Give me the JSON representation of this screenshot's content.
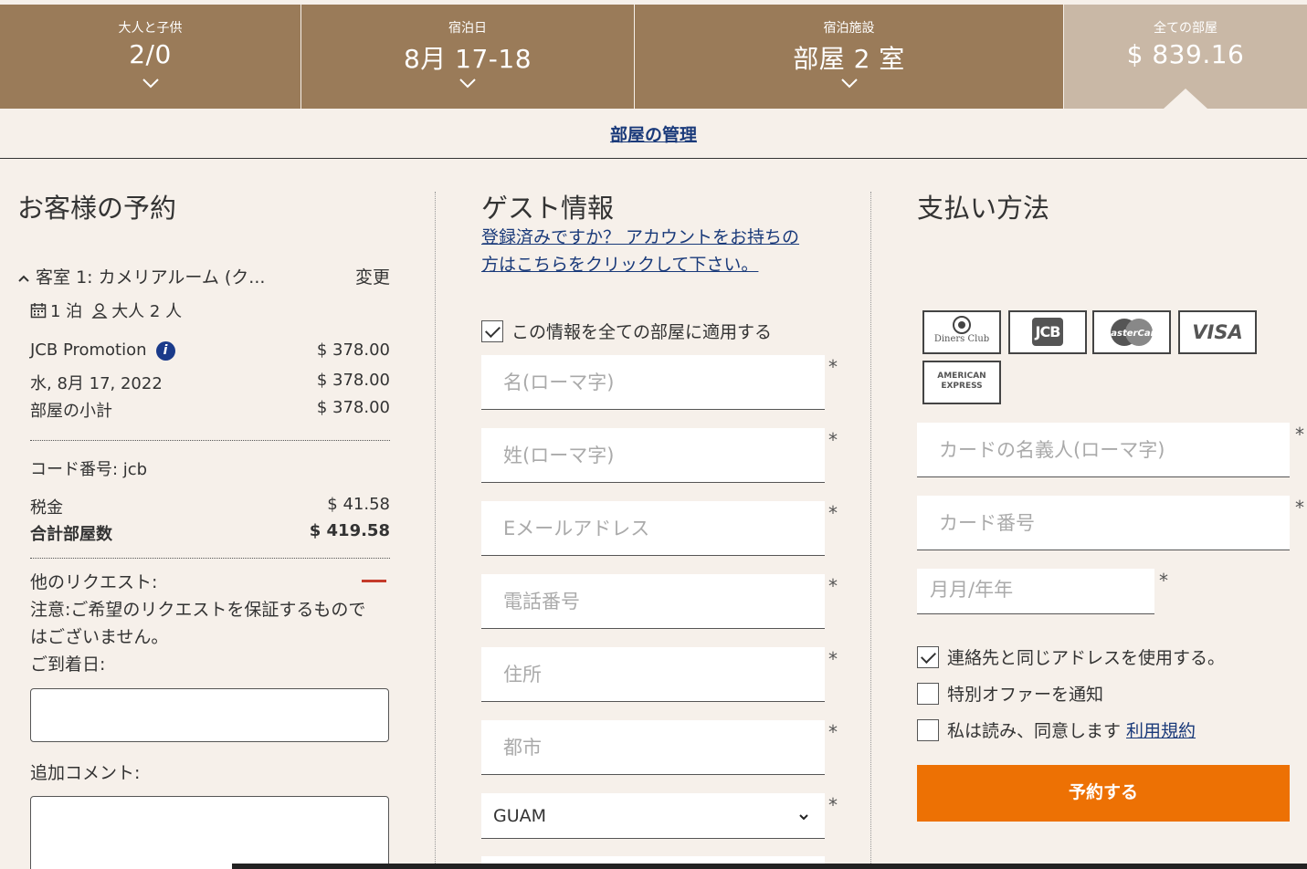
{
  "header": {
    "guests": {
      "label": "大人と子供",
      "value": "2/0"
    },
    "dates": {
      "label": "宿泊日",
      "value": "8月 17-18"
    },
    "property": {
      "label": "宿泊施設",
      "value": "部屋 2 室"
    },
    "total": {
      "label": "全ての部屋",
      "value": "$ 839.16"
    }
  },
  "manage_rooms": "部屋の管理",
  "reservation": {
    "title": "お客様の予約",
    "room_name": "客室 1: カメリアルーム (ク...",
    "change": "変更",
    "nights": "1 泊",
    "adults": "大人 2 人",
    "rate_name": "JCB Promotion",
    "rate_price": "$ 378.00",
    "date": "水, 8月 17, 2022",
    "date_price": "$ 378.00",
    "subtotal_label": "部屋の小計",
    "subtotal": "$ 378.00",
    "code": "コード番号: jcb",
    "tax_label": "税金",
    "tax": "$ 41.58",
    "total_label": "合計部屋数",
    "total": "$ 419.58",
    "requests_label": "他のリクエスト:",
    "notice_line1": "注意:ご希望のリクエストを保証するもので",
    "notice_line2": "はございません。",
    "arrival_label": "ご到着日:",
    "comment_label": "追加コメント:"
  },
  "guest": {
    "title": "ゲスト情報",
    "login_line1": "登録済みですか？ アカウントをお持ちの",
    "login_line2": "方はこちらをクリックして下さい。",
    "apply_all": "この情報を全ての部屋に適用する",
    "first_name": "名(ローマ字)",
    "last_name": "姓(ローマ字)",
    "email": "Eメールアドレス",
    "phone": "電話番号",
    "address": "住所",
    "city": "都市",
    "country": "GUAM",
    "required": "*"
  },
  "payment": {
    "title": "支払い方法",
    "cards": {
      "diners_line1": "Diners Club",
      "jcb": "JCB",
      "master": "MasterCard",
      "visa": "VISA",
      "amex_line1": "AMERICAN",
      "amex_line2": "EXPRESS"
    },
    "cardholder": "カードの名義人(ローマ字)",
    "card_number": "カード番号",
    "expiry": "月月/年年",
    "same_address": "連絡先と同じアドレスを使用する。",
    "offers": "特別オファーを通知",
    "agree": "私は読み、同意します",
    "terms": "利用規約",
    "book": "予約する"
  }
}
